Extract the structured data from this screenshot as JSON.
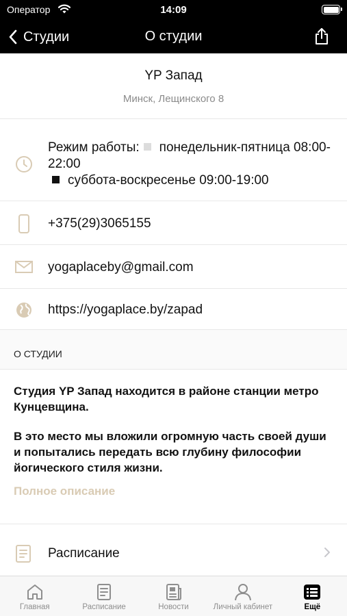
{
  "status_bar": {
    "carrier": "Оператор",
    "time": "14:09"
  },
  "nav": {
    "back_label": "Студии",
    "title": "О студии"
  },
  "studio": {
    "name": "YP Запад",
    "address": "Минск, Лещинского 8"
  },
  "hours": {
    "label": "Режим работы:",
    "weekday": "понедельник-пятница 08:00-22:00",
    "weekend": "суббота-воскресенье 09:00-19:00"
  },
  "contacts": {
    "phone": "+375(29)3065155",
    "email": "yogaplaceby@gmail.com",
    "website": "https://yogaplace.by/zapad"
  },
  "about": {
    "section_title": "О СТУДИИ",
    "paragraph1": "Студия YP Запад находится в районе станции метро Кунцевщина.",
    "paragraph2": "В это место мы вложили огромную часть своей души и попытались передать всю глубину философии йогического стиля жизни.",
    "full_description_link": "Полное описание"
  },
  "schedule": {
    "label": "Расписание"
  },
  "tab_bar": {
    "tabs": [
      {
        "label": "Главная",
        "icon": "home-icon"
      },
      {
        "label": "Расписание",
        "icon": "schedule-icon"
      },
      {
        "label": "Новости",
        "icon": "news-icon"
      },
      {
        "label": "Личный кабинет",
        "icon": "person-icon"
      },
      {
        "label": "Ещё",
        "icon": "more-icon",
        "active": true
      }
    ]
  },
  "colors": {
    "accent": "#d9cbb4",
    "bar_background": "#000000",
    "inactive_tab": "#8e8e8e"
  }
}
